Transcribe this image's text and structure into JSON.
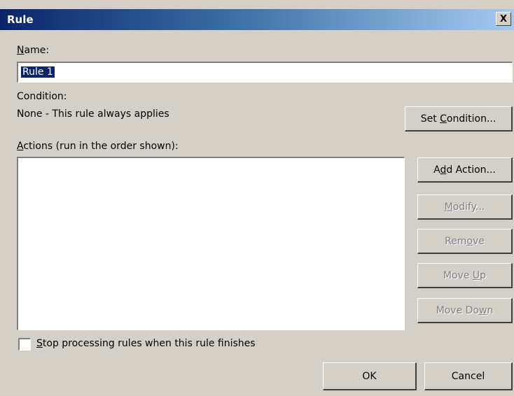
{
  "window": {
    "title": "Rule",
    "close_glyph": "X"
  },
  "name": {
    "label_key": "N",
    "label_rest": "ame:",
    "value": "Rule 1"
  },
  "condition": {
    "label": "Condition:",
    "text": "None - This rule always applies",
    "button_pre": "Set ",
    "button_key": "C",
    "button_post": "ondition..."
  },
  "actions": {
    "label_key": "A",
    "label_rest": "ctions (run in the order shown):",
    "items": []
  },
  "buttons": {
    "add_pre": "A",
    "add_key": "d",
    "add_post": "d Action...",
    "modify_key": "M",
    "modify_post": "odify...",
    "remove_pre": "Rem",
    "remove_key": "o",
    "remove_post": "ve",
    "moveup_pre": "Move ",
    "moveup_key": "U",
    "moveup_post": "p",
    "movedown_pre": "Move Do",
    "movedown_key": "w",
    "movedown_post": "n",
    "ok": "OK",
    "cancel": "Cancel"
  },
  "stop": {
    "label_key": "S",
    "label_rest": "top processing rules when this rule finishes",
    "checked": false
  }
}
